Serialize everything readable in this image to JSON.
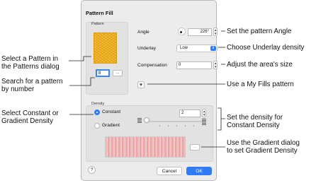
{
  "dialog": {
    "title": "Pattern Fill",
    "pattern_group": {
      "label": "Pattern",
      "number_value": "8",
      "browse_label": "..."
    },
    "angle": {
      "label": "Angle",
      "value": "226°"
    },
    "underlay": {
      "label": "Underlay",
      "value": "Low"
    },
    "compensation": {
      "label": "Compensation",
      "value": "0"
    },
    "my_fills_icon": "heart-icon",
    "density_group": {
      "label": "Density",
      "constant_label": "Constant",
      "gradient_label": "Gradient",
      "selected": "Constant",
      "value": "2",
      "gradient_button_label": "..."
    },
    "help_label": "?",
    "cancel_label": "Cancel",
    "ok_label": "OK"
  },
  "callouts": {
    "select_pattern": "Select a Pattern in\nthe Patterns dialog",
    "search_pattern": "Search for a pattern\nby number",
    "select_density": "Select Constant or\nGradient Density",
    "set_angle": "Set the pattern Angle",
    "choose_underlay": "Choose Underlay density",
    "adjust_area": "Adjust the area's size",
    "use_my_fills": "Use a My Fills pattern",
    "set_density": "Set the density for\nConstant Density",
    "use_gradient": "Use the Gradient dialog\nto set Gradient Density"
  },
  "colors": {
    "accent": "#2f7cf6",
    "pattern_swatch": "#f0ad15",
    "gradient_preview": "#f0b8b8"
  }
}
